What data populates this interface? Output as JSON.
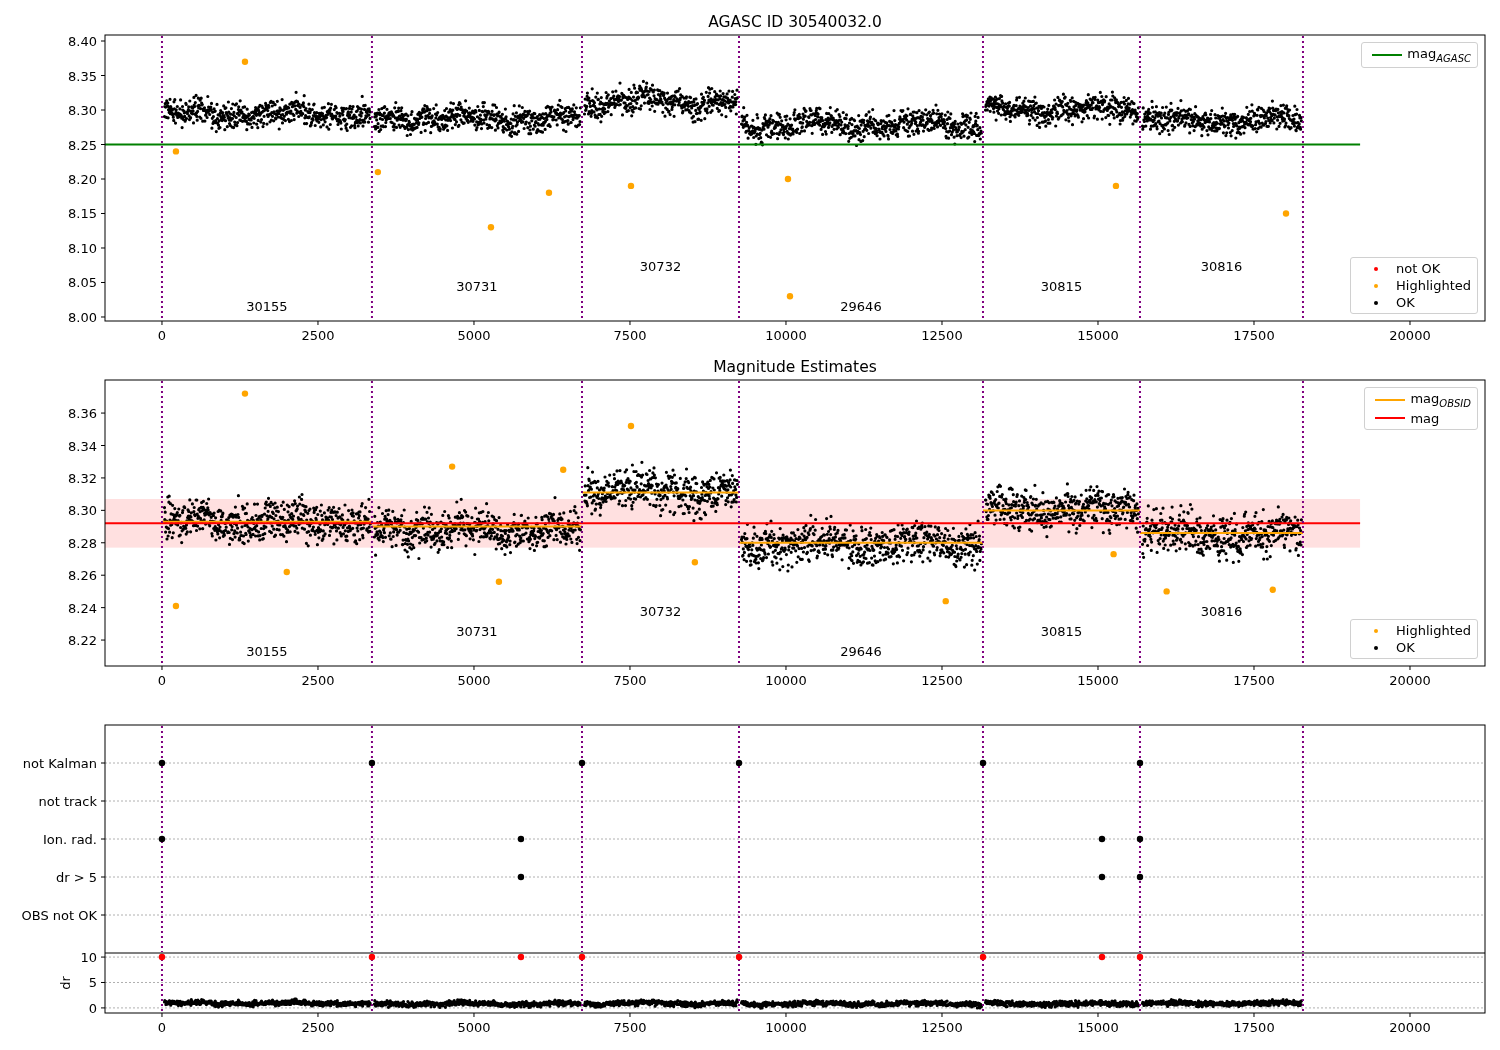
{
  "figure": {
    "charts": [
      {
        "chart_data": {
          "type": "scatter",
          "title": "AGASC ID 30540032.0",
          "xlim": [
            -913,
            21202
          ],
          "ylim": [
            7.9942,
            8.4087
          ],
          "xticks": [
            {
              "value": 0,
              "label": "0"
            },
            {
              "value": 2500,
              "label": "2500"
            },
            {
              "value": 5000,
              "label": "5000"
            },
            {
              "value": 7500,
              "label": "7500"
            },
            {
              "value": 10000,
              "label": "10000"
            },
            {
              "value": 12500,
              "label": "12500"
            },
            {
              "value": 15000,
              "label": "15000"
            },
            {
              "value": 17500,
              "label": "17500"
            },
            {
              "value": 20000,
              "label": "20000"
            }
          ],
          "yticks": [
            {
              "value": 8.0,
              "label": "8.00"
            },
            {
              "value": 8.05,
              "label": "8.05"
            },
            {
              "value": 8.1,
              "label": "8.10"
            },
            {
              "value": 8.15,
              "label": "8.15"
            },
            {
              "value": 8.2,
              "label": "8.20"
            },
            {
              "value": 8.25,
              "label": "8.25"
            },
            {
              "value": 8.3,
              "label": "8.30"
            },
            {
              "value": 8.35,
              "label": "8.35"
            },
            {
              "value": 8.4,
              "label": "8.40"
            }
          ],
          "series": [
            {
              "name": "mag$_{AGASC}$",
              "type": "line",
              "color": "#008000",
              "x": [
                -913,
                19200
              ],
              "values": [
                8.25,
                8.25
              ]
            },
            {
              "name": "not OK",
              "type": "scatter",
              "color": "#ff0000"
            },
            {
              "name": "Highlighted",
              "type": "scatter",
              "color": "#ffa500",
              "x": [
                224,
                1330,
                3460,
                5272,
                6202,
                7516,
                10032,
                10064,
                15288,
                18013
              ],
              "values": [
                8.24,
                8.37,
                8.21,
                8.13,
                8.18,
                8.19,
                8.2,
                8.03,
                8.19,
                8.15
              ]
            },
            {
              "name": "OK",
              "type": "scatter",
              "color": "#000000"
            }
          ],
          "ref_lines": [
            {
              "axis": "x",
              "value": 0
            },
            {
              "axis": "x",
              "value": 3365
            },
            {
              "axis": "x",
              "value": 6731
            },
            {
              "axis": "x",
              "value": 9247
            },
            {
              "axis": "x",
              "value": 13157
            },
            {
              "axis": "x",
              "value": 15673
            },
            {
              "axis": "x",
              "value": 18285
            }
          ],
          "annotations": [
            "30155",
            "30731",
            "30732",
            "29646",
            "30815",
            "30816"
          ]
        }
      },
      {
        "chart_data": {
          "type": "scatter",
          "title": "Magnitude Estimates",
          "xlim": [
            -913,
            21202
          ],
          "ylim": [
            8.204,
            8.3804
          ],
          "xticks": [
            {
              "value": 0,
              "label": "0"
            },
            {
              "value": 2500,
              "label": "2500"
            },
            {
              "value": 5000,
              "label": "5000"
            },
            {
              "value": 7500,
              "label": "7500"
            },
            {
              "value": 10000,
              "label": "10000"
            },
            {
              "value": 12500,
              "label": "12500"
            },
            {
              "value": 15000,
              "label": "15000"
            },
            {
              "value": 17500,
              "label": "17500"
            },
            {
              "value": 20000,
              "label": "20000"
            }
          ],
          "yticks": [
            {
              "value": 8.22,
              "label": "8.22"
            },
            {
              "value": 8.24,
              "label": "8.24"
            },
            {
              "value": 8.26,
              "label": "8.26"
            },
            {
              "value": 8.28,
              "label": "8.28"
            },
            {
              "value": 8.3,
              "label": "8.30"
            },
            {
              "value": 8.32,
              "label": "8.32"
            },
            {
              "value": 8.34,
              "label": "8.34"
            },
            {
              "value": 8.36,
              "label": "8.36"
            }
          ],
          "series": [
            {
              "name": "mag$_{OBSID}$",
              "type": "line",
              "color": "#ffa500",
              "x": [
                0,
                3365,
                null,
                3365,
                6731,
                null,
                6731,
                9247,
                null,
                9247,
                13157,
                null,
                13157,
                15673,
                null,
                15673,
                18285
              ],
              "values": [
                8.293,
                8.293,
                null,
                8.29,
                8.29,
                null,
                8.311,
                8.311,
                null,
                8.28,
                8.28,
                null,
                8.3,
                8.3,
                null,
                8.286,
                8.286
              ]
            },
            {
              "name": "mag",
              "type": "line",
              "color": "#ff0000",
              "x": [
                -913,
                19200
              ],
              "values": [
                8.292,
                8.292
              ]
            },
            {
              "name": "Highlighted",
              "type": "scatter",
              "color": "#ffa500",
              "x": [
                224,
                1330,
                2000,
                4650,
                5400,
                6430,
                7516,
                8540,
                12560,
                15250,
                16100,
                17800
              ],
              "values": [
                8.241,
                8.372,
                8.262,
                8.327,
                8.256,
                8.325,
                8.352,
                8.268,
                8.244,
                8.273,
                8.25,
                8.251
              ]
            },
            {
              "name": "OK",
              "type": "scatter",
              "color": "#000000"
            }
          ],
          "bands": [
            {
              "axis": "y",
              "from": 8.277,
              "to": 8.307,
              "color": "#ff0000"
            }
          ],
          "ref_lines": [
            {
              "axis": "x",
              "value": 0
            },
            {
              "axis": "x",
              "value": 3365
            },
            {
              "axis": "x",
              "value": 6731
            },
            {
              "axis": "x",
              "value": 9247
            },
            {
              "axis": "x",
              "value": 13157
            },
            {
              "axis": "x",
              "value": 15673
            },
            {
              "axis": "x",
              "value": 18285
            }
          ],
          "annotations": [
            "30155",
            "30731",
            "30732",
            "29646",
            "30815",
            "30816"
          ]
        }
      },
      {
        "chart_data": {
          "type": "scatter",
          "orientation": "horizontal",
          "grid": true,
          "xlim": [
            -913,
            21202
          ],
          "categories": [
            "not Kalman",
            "not track",
            "Ion. rad.",
            "dr > 5",
            "OBS not OK"
          ],
          "series": [
            {
              "color": "#000000",
              "values": [
                0,
                null,
                0,
                null,
                null
              ]
            },
            {
              "color": "#000000",
              "values": [
                3365,
                null,
                null,
                null,
                null
              ]
            },
            {
              "color": "#000000",
              "values": [
                null,
                null,
                5753,
                5753,
                null
              ]
            },
            {
              "color": "#000000",
              "values": [
                6731,
                null,
                null,
                null,
                null
              ]
            },
            {
              "color": "#000000",
              "values": [
                9247,
                null,
                null,
                null,
                null
              ]
            },
            {
              "color": "#000000",
              "values": [
                13157,
                null,
                null,
                null,
                null
              ]
            },
            {
              "color": "#000000",
              "values": [
                null,
                null,
                15064,
                15064,
                null
              ]
            },
            {
              "color": "#000000",
              "values": [
                15673,
                null,
                15673,
                15673,
                null
              ]
            }
          ],
          "ref_lines": [
            {
              "axis": "x",
              "value": 0
            },
            {
              "axis": "x",
              "value": 3365
            },
            {
              "axis": "x",
              "value": 6731
            },
            {
              "axis": "x",
              "value": 9247
            },
            {
              "axis": "x",
              "value": 13157
            },
            {
              "axis": "x",
              "value": 15673
            },
            {
              "axis": "x",
              "value": 18285
            }
          ]
        }
      },
      {
        "chart_data": {
          "type": "scatter",
          "ylabel": "dr",
          "grid": true,
          "xlim": [
            -913,
            21202
          ],
          "ylim": [
            -1,
            10.8
          ],
          "xticks": [
            {
              "value": 0,
              "label": "0"
            },
            {
              "value": 2500,
              "label": "2500"
            },
            {
              "value": 5000,
              "label": "5000"
            },
            {
              "value": 7500,
              "label": "7500"
            },
            {
              "value": 10000,
              "label": "10000"
            },
            {
              "value": 12500,
              "label": "12500"
            },
            {
              "value": 15000,
              "label": "15000"
            },
            {
              "value": 17500,
              "label": "17500"
            },
            {
              "value": 20000,
              "label": "20000"
            }
          ],
          "yticks": [
            {
              "value": 0,
              "label": "0"
            },
            {
              "value": 5,
              "label": "5"
            },
            {
              "value": 10,
              "label": "10"
            }
          ],
          "series": [
            {
              "type": "scatter",
              "color": "#ff0000",
              "x": [
                0,
                3365,
                5753,
                6731,
                9247,
                13157,
                15064,
                15673
              ],
              "values": [
                10,
                10,
                10,
                10,
                10,
                10,
                10,
                10
              ]
            }
          ],
          "ref_lines": [
            {
              "axis": "x",
              "value": 0
            },
            {
              "axis": "x",
              "value": 3365
            },
            {
              "axis": "x",
              "value": 6731
            },
            {
              "axis": "x",
              "value": 9247
            },
            {
              "axis": "x",
              "value": 13157
            },
            {
              "axis": "x",
              "value": 15673
            },
            {
              "axis": "x",
              "value": 18285
            }
          ]
        }
      }
    ]
  }
}
